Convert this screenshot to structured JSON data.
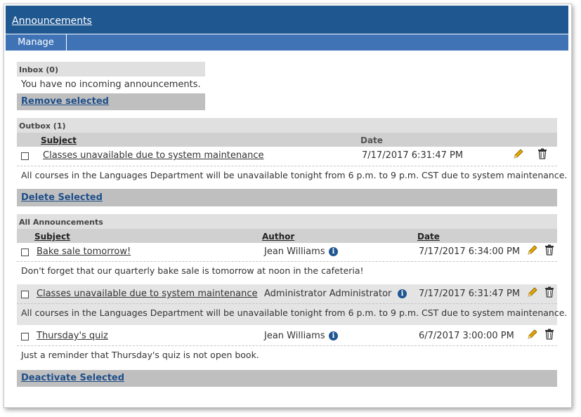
{
  "header": {
    "title": "Announcements"
  },
  "menu": {
    "manage": "Manage"
  },
  "inbox": {
    "heading": "Inbox (0)",
    "empty_message": "You have no incoming announcements.",
    "remove_label": "Remove selected"
  },
  "outbox": {
    "heading": "Outbox (1)",
    "columns": {
      "subject": "Subject",
      "date": "Date"
    },
    "rows": [
      {
        "subject": "Classes unavailable due to system maintenance",
        "date": "7/17/2017 6:31:47 PM",
        "body": "All courses in the Languages Department will be unavailable tonight from 6 p.m. to 9 p.m. CST due to system maintenance."
      }
    ],
    "delete_label": "Delete Selected"
  },
  "all": {
    "heading": "All Announcements",
    "columns": {
      "subject": "Subject",
      "author": "Author",
      "date": "Date"
    },
    "rows": [
      {
        "subject": "Bake sale tomorrow!",
        "author": "Jean Williams",
        "date": "7/17/2017 6:34:00 PM",
        "body": "Don't forget that our quarterly bake sale is tomorrow at noon in the cafeteria!"
      },
      {
        "subject": "Classes unavailable due to system maintenance",
        "author": "Administrator Administrator",
        "date": "7/17/2017 6:31:47 PM",
        "body": "All courses in the Languages Department will be unavailable tonight from 6 p.m. to 9 p.m. CST due to system maintenance."
      },
      {
        "subject": "Thursday's quiz",
        "author": "Jean Williams",
        "date": "6/7/2017 3:00:00 PM",
        "body": "Just a reminder that Thursday's quiz is not open book."
      }
    ],
    "deactivate_label": "Deactivate Selected"
  },
  "icons": {
    "edit": "pencil-icon",
    "delete": "trash-icon",
    "info": "info-icon"
  },
  "colors": {
    "header_bg": "#1f5791",
    "menu_bg": "#3f73b6",
    "link": "#1f4f8a",
    "pencil": "#e5a800"
  }
}
